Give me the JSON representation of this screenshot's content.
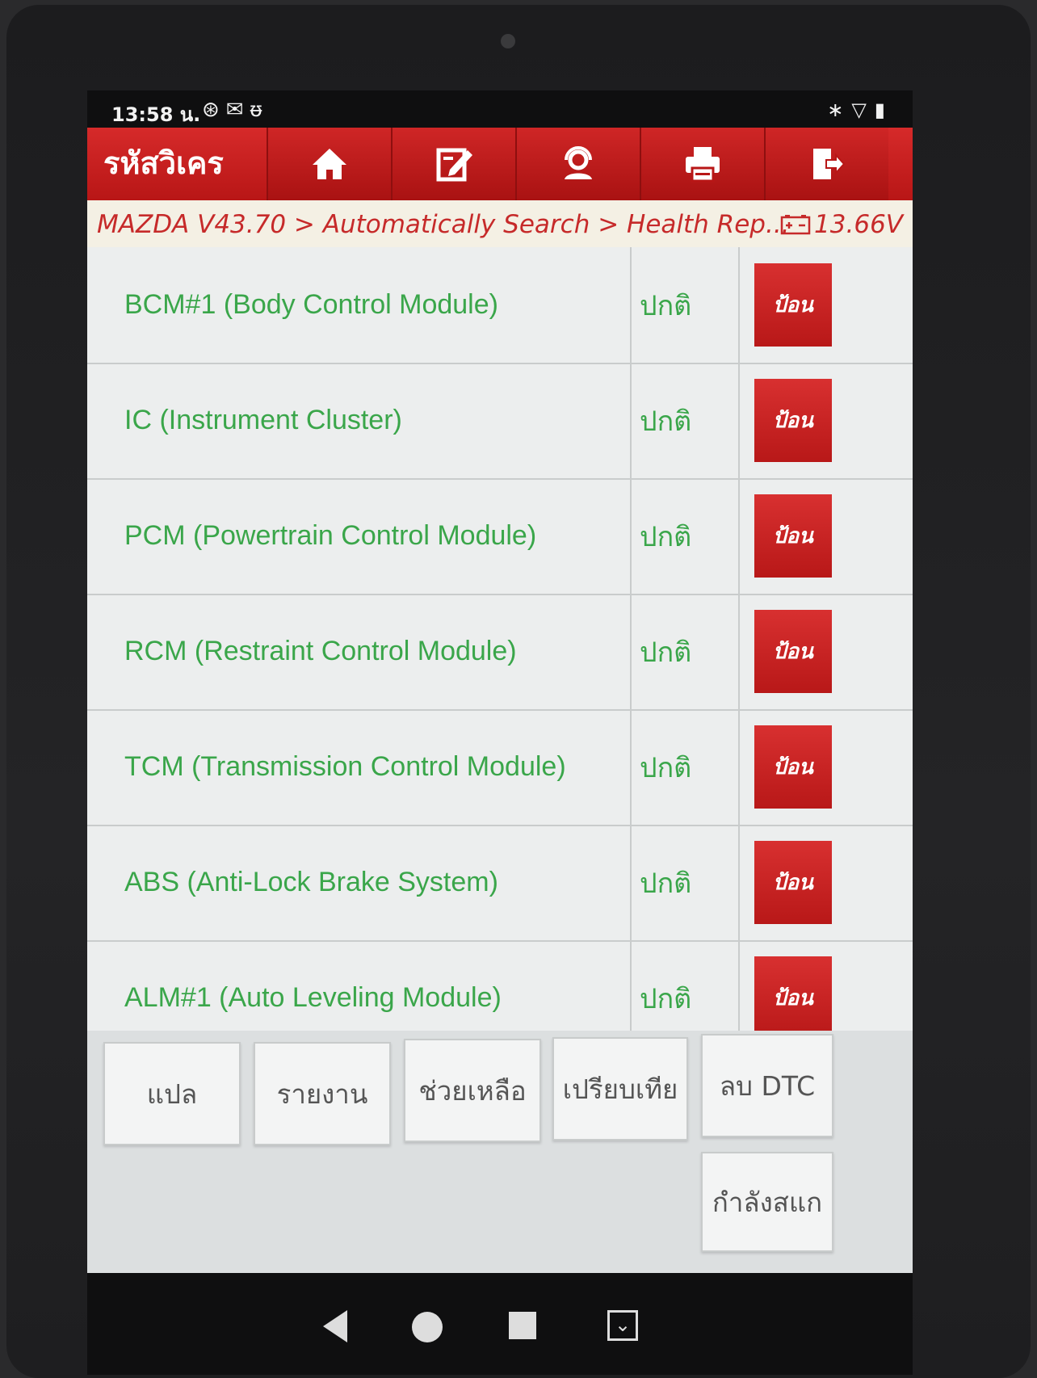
{
  "status_bar": {
    "time": "13:58 น.",
    "left_icons": [
      "target-icon",
      "mail-icon",
      "stethoscope-icon"
    ],
    "right_icons": [
      "bluetooth-icon",
      "wifi-icon",
      "battery-icon"
    ]
  },
  "header": {
    "title": "รหัสวิเคร",
    "toolbar_icons": [
      "home-icon",
      "edit-icon",
      "support-icon",
      "print-icon",
      "exit-icon"
    ]
  },
  "breadcrumb": {
    "path": "MAZDA V43.70 > Automatically Search > Health Rep...",
    "voltage": "13.66V"
  },
  "modules": [
    {
      "name": "BCM#1 (Body Control Module)",
      "status": "ปกติ",
      "action": "ป้อน"
    },
    {
      "name": "IC (Instrument Cluster)",
      "status": "ปกติ",
      "action": "ป้อน"
    },
    {
      "name": "PCM (Powertrain Control Module)",
      "status": "ปกติ",
      "action": "ป้อน"
    },
    {
      "name": "RCM (Restraint Control Module)",
      "status": "ปกติ",
      "action": "ป้อน"
    },
    {
      "name": "TCM (Transmission Control Module)",
      "status": "ปกติ",
      "action": "ป้อน"
    },
    {
      "name": "ABS (Anti-Lock Brake System)",
      "status": "ปกติ",
      "action": "ป้อน"
    },
    {
      "name": "ALM#1 (Auto Leveling Module)",
      "status": "ปกติ",
      "action": "ป้อน"
    }
  ],
  "bottom_buttons": {
    "translate": "แปล",
    "report": "รายงาน",
    "help": "ช่วยเหลือ",
    "compare": "เปรียบเทีย",
    "clear_dtc": "ลบ DTC",
    "scanning": "กำลังสแก"
  },
  "colors": {
    "header_red": "#c41e1e",
    "module_green": "#3aa64a",
    "breadcrumb_red": "#c62a2a"
  }
}
